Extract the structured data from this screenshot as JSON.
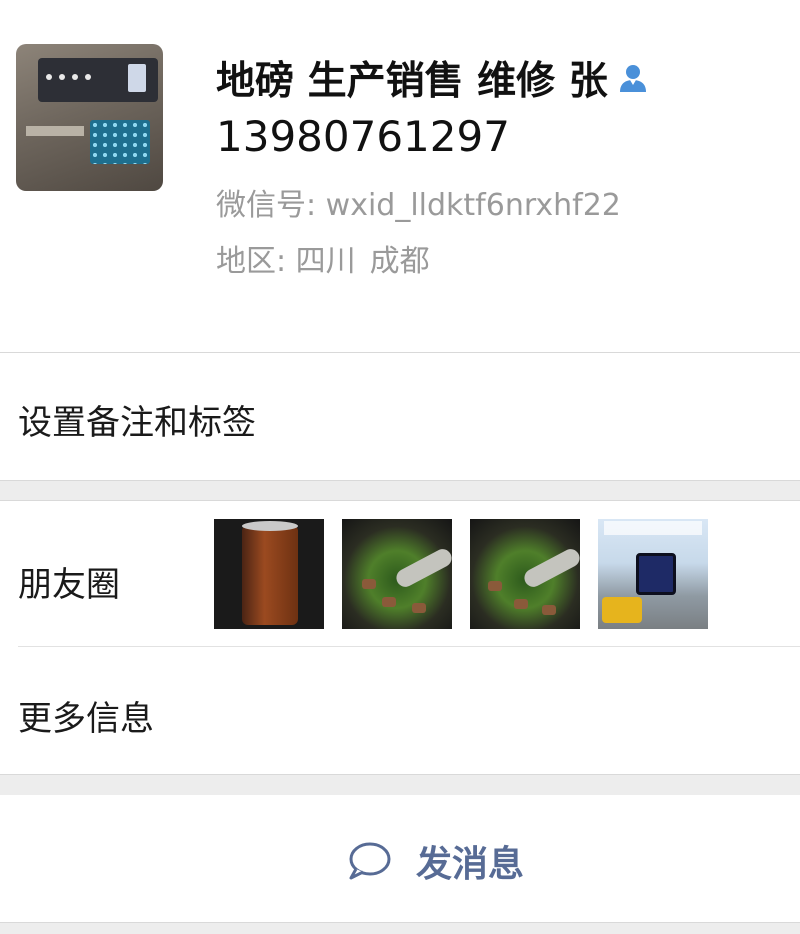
{
  "profile": {
    "name": "地磅 生产销售 维修 张",
    "phone": "13980761297",
    "wechat_id_label": "微信号:",
    "wechat_id": "wxid_lldktf6nrxhf22",
    "region_label": "地区:",
    "region_province": "四川",
    "region_city": "成都",
    "verified_icon": "user-icon"
  },
  "rows": {
    "remark_tags": "设置备注和标签",
    "moments": "朋友圈",
    "more_info": "更多信息"
  },
  "moments_thumbnails": [
    {
      "name": "moment-thumb-can"
    },
    {
      "name": "moment-thumb-food-1"
    },
    {
      "name": "moment-thumb-food-2"
    },
    {
      "name": "moment-thumb-ad"
    }
  ],
  "actions": {
    "send_message": "发消息",
    "send_icon": "chat-bubble-icon"
  },
  "colors": {
    "link_blue": "#576b95",
    "icon_blue": "#4a90d9",
    "secondary_text": "#9a9a9a",
    "section_gap": "#ededed"
  }
}
